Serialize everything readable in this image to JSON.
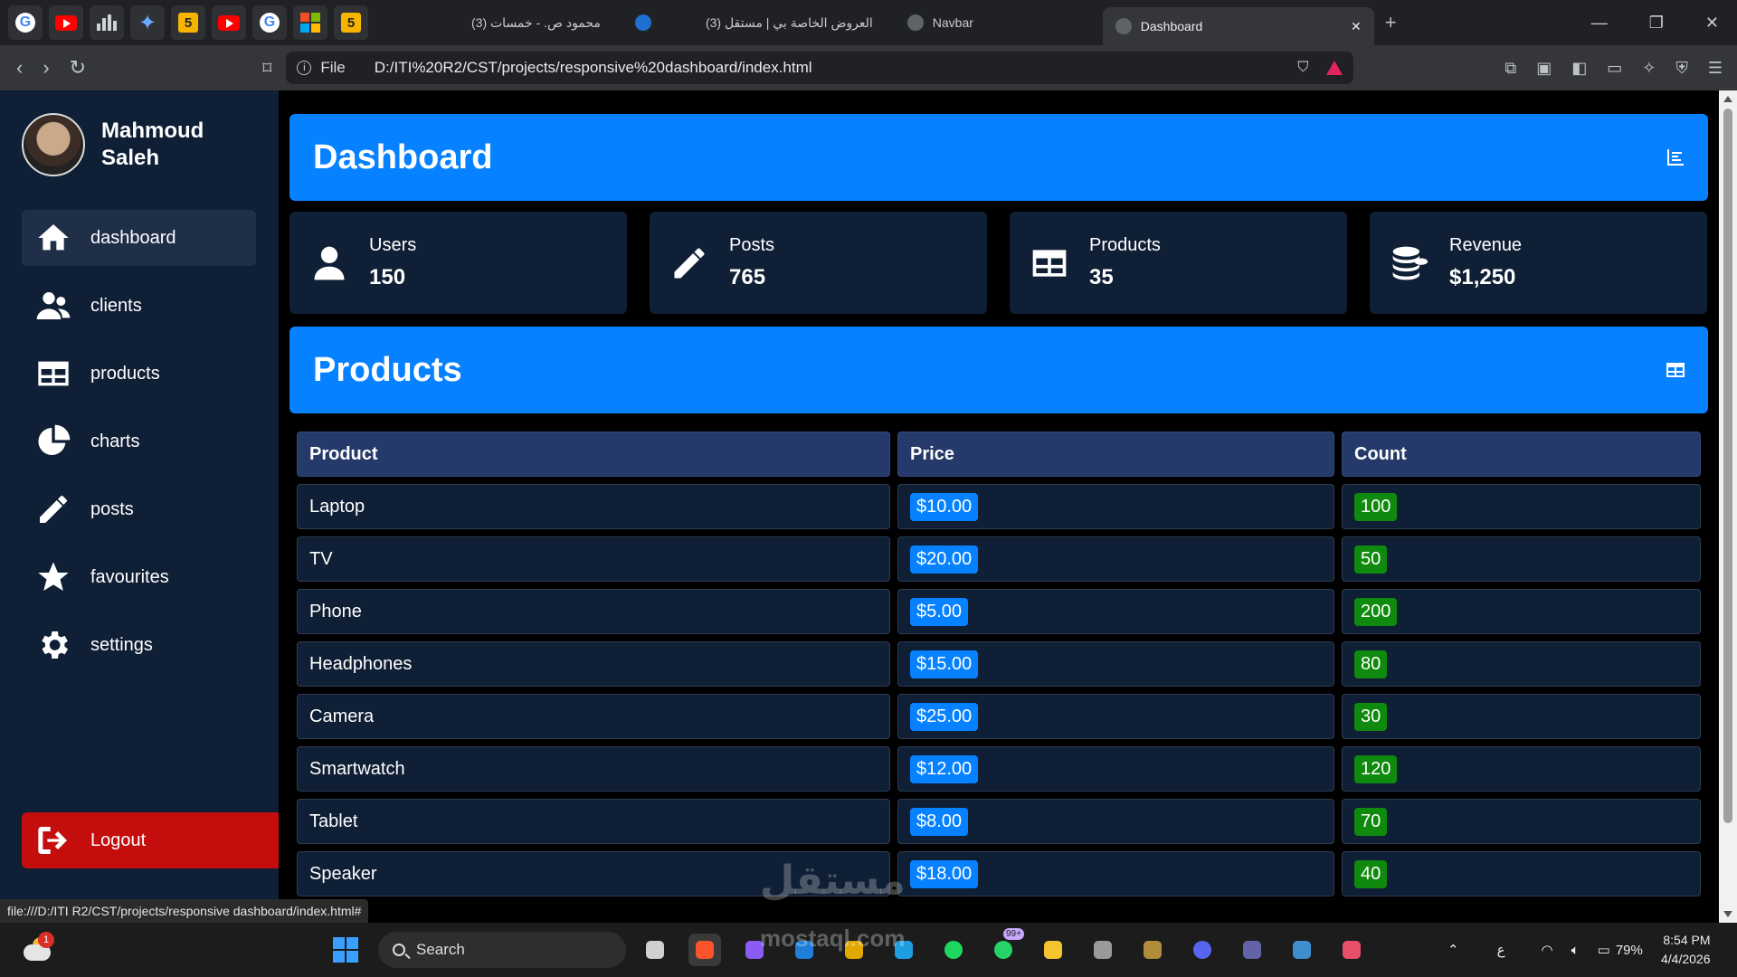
{
  "browser": {
    "tabs": [
      {
        "label": "(3) محمود ص. - خمسات"
      },
      {
        "label": "(3) العروض الخاصة بي | مستقل"
      },
      {
        "label": "Navbar"
      },
      {
        "label": "Dashboard"
      }
    ],
    "address": {
      "scheme_label": "File",
      "url": "D:/ITI%20R2/CST/projects/responsive%20dashboard/index.html"
    },
    "status_url": "file:///D:/ITI R2/CST/projects/responsive dashboard/index.html#"
  },
  "sidebar": {
    "user_name_line1": "Mahmoud",
    "user_name_line2": "Saleh",
    "items": [
      {
        "label": "dashboard",
        "icon": "home-icon"
      },
      {
        "label": "clients",
        "icon": "users-icon"
      },
      {
        "label": "products",
        "icon": "table-icon"
      },
      {
        "label": "charts",
        "icon": "pie-chart-icon"
      },
      {
        "label": "posts",
        "icon": "pencil-icon"
      },
      {
        "label": "favourites",
        "icon": "star-icon"
      },
      {
        "label": "settings",
        "icon": "gear-icon"
      }
    ],
    "logout_label": "Logout"
  },
  "dashboard": {
    "title": "Dashboard",
    "stats": [
      {
        "label": "Users",
        "value": "150",
        "icon": "user-icon"
      },
      {
        "label": "Posts",
        "value": "765",
        "icon": "pencil-icon"
      },
      {
        "label": "Products",
        "value": "35",
        "icon": "table-icon"
      },
      {
        "label": "Revenue",
        "value": "$1,250",
        "icon": "coins-icon"
      }
    ]
  },
  "products": {
    "title": "Products",
    "columns": [
      "Product",
      "Price",
      "Count"
    ],
    "rows": [
      {
        "product": "Laptop",
        "price": "$10.00",
        "count": "100"
      },
      {
        "product": "TV",
        "price": "$20.00",
        "count": "50"
      },
      {
        "product": "Phone",
        "price": "$5.00",
        "count": "200"
      },
      {
        "product": "Headphones",
        "price": "$15.00",
        "count": "80"
      },
      {
        "product": "Camera",
        "price": "$25.00",
        "count": "30"
      },
      {
        "product": "Smartwatch",
        "price": "$12.00",
        "count": "120"
      },
      {
        "product": "Tablet",
        "price": "$8.00",
        "count": "70"
      },
      {
        "product": "Speaker",
        "price": "$18.00",
        "count": "40"
      }
    ]
  },
  "taskbar": {
    "search_label": "Search",
    "weather_badge": "1",
    "whatsapp_badge": "99+",
    "battery": "79%",
    "lang": "ع",
    "time": "8:54 PM",
    "date": "4/4/2026"
  },
  "watermark": {
    "text": "مستقل",
    "sub": "mostaql.com"
  },
  "colors": {
    "accent": "#0681ff",
    "sidebar": "#0f1f35",
    "logout": "#c40d0d",
    "count_badge": "#0f8a0f",
    "table_header": "#253a6b"
  }
}
